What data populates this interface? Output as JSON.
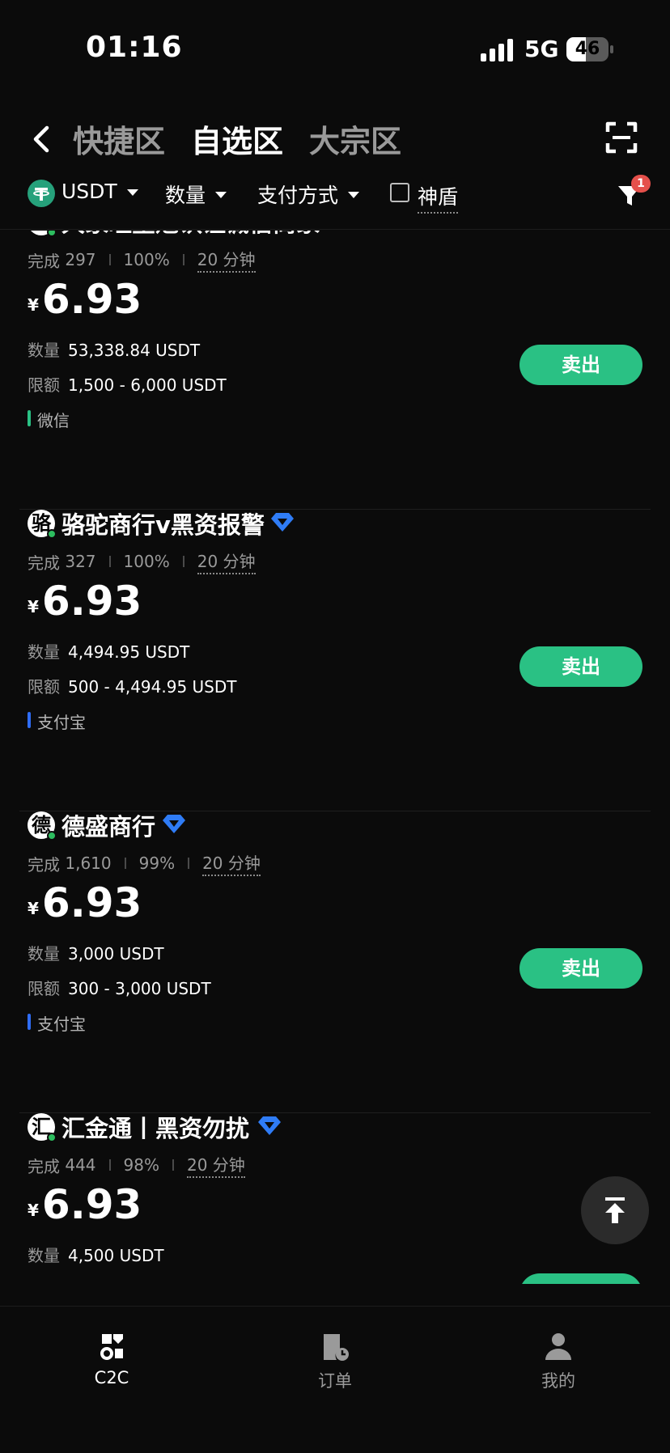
{
  "status_bar": {
    "time": "01:16",
    "network": "5G",
    "battery": "46",
    "battery_level": 0.46
  },
  "header": {
    "tabs": [
      {
        "label": "快捷区",
        "active": false
      },
      {
        "label": "自选区",
        "active": true
      },
      {
        "label": "大宗区",
        "active": false
      }
    ]
  },
  "filters": {
    "coin": "USDT",
    "amount_label": "数量",
    "payment_label": "支付方式",
    "shield_label": "神盾",
    "filter_badge": "1"
  },
  "listings": [
    {
      "avatar": "大",
      "name": "大家旺皇冠认证诚信商家",
      "badge_icon": "crown-badge-icon",
      "badge_color": "#f0952c",
      "completed_label": "完成",
      "completed": "297",
      "rate": "100%",
      "time": "20 分钟",
      "currency": "¥",
      "price": "6.93",
      "qty_label": "数量",
      "qty": "53,338.84 USDT",
      "limit_label": "限额",
      "limit": "1,500 - 6,000 USDT",
      "payment": "微信",
      "payment_color": "#2ac184",
      "action": "卖出"
    },
    {
      "avatar": "骆",
      "name": "骆驼商行v黑资报警",
      "badge_icon": "diamond-badge-icon",
      "badge_color": "#2f7cf6",
      "completed_label": "完成",
      "completed": "327",
      "rate": "100%",
      "time": "20 分钟",
      "currency": "¥",
      "price": "6.93",
      "qty_label": "数量",
      "qty": "4,494.95 USDT",
      "limit_label": "限额",
      "limit": "500 - 4,494.95 USDT",
      "payment": "支付宝",
      "payment_color": "#2f6df6",
      "action": "卖出"
    },
    {
      "avatar": "德",
      "name": "德盛商行",
      "badge_icon": "diamond-badge-icon",
      "badge_color": "#2f7cf6",
      "completed_label": "完成",
      "completed": "1,610",
      "rate": "99%",
      "time": "20 分钟",
      "currency": "¥",
      "price": "6.93",
      "qty_label": "数量",
      "qty": "3,000 USDT",
      "limit_label": "限额",
      "limit": "300 - 3,000 USDT",
      "payment": "支付宝",
      "payment_color": "#2f6df6",
      "action": "卖出"
    },
    {
      "avatar": "汇",
      "name": "汇金通丨黑资勿扰",
      "badge_icon": "diamond-badge-icon",
      "badge_color": "#2f7cf6",
      "completed_label": "完成",
      "completed": "444",
      "rate": "98%",
      "time": "20 分钟",
      "currency": "¥",
      "price": "6.93",
      "qty_label": "数量",
      "qty": "4,500 USDT",
      "action": "卖出"
    }
  ],
  "bottom_nav": [
    {
      "label": "C2C",
      "icon": "c2c-icon",
      "active": true
    },
    {
      "label": "订单",
      "icon": "order-icon",
      "active": false
    },
    {
      "label": "我的",
      "icon": "profile-icon",
      "active": false
    }
  ]
}
